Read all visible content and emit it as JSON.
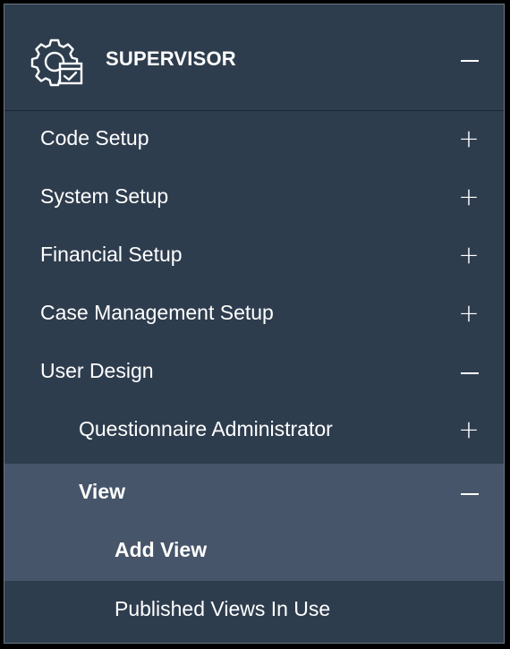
{
  "header": {
    "title": "SUPERVISOR",
    "icon": "supervisor-gear-icon",
    "toggle_icon": "minus"
  },
  "menu": {
    "items": [
      {
        "label": "Code Setup",
        "toggle": "+"
      },
      {
        "label": "System Setup",
        "toggle": "+"
      },
      {
        "label": "Financial Setup",
        "toggle": "+"
      },
      {
        "label": "Case Management Setup",
        "toggle": "+"
      },
      {
        "label": "User Design",
        "toggle": "minus"
      },
      {
        "label": "Questionnaire Administrator",
        "toggle": "+"
      },
      {
        "label": "View",
        "toggle": "minus"
      },
      {
        "label": "Add View"
      },
      {
        "label": "Published Views In Use"
      }
    ]
  },
  "colors": {
    "panel_bg": "#2e3d4e",
    "highlight_bg": "#46556a",
    "text": "#ffffff",
    "border": "#6b7785"
  }
}
